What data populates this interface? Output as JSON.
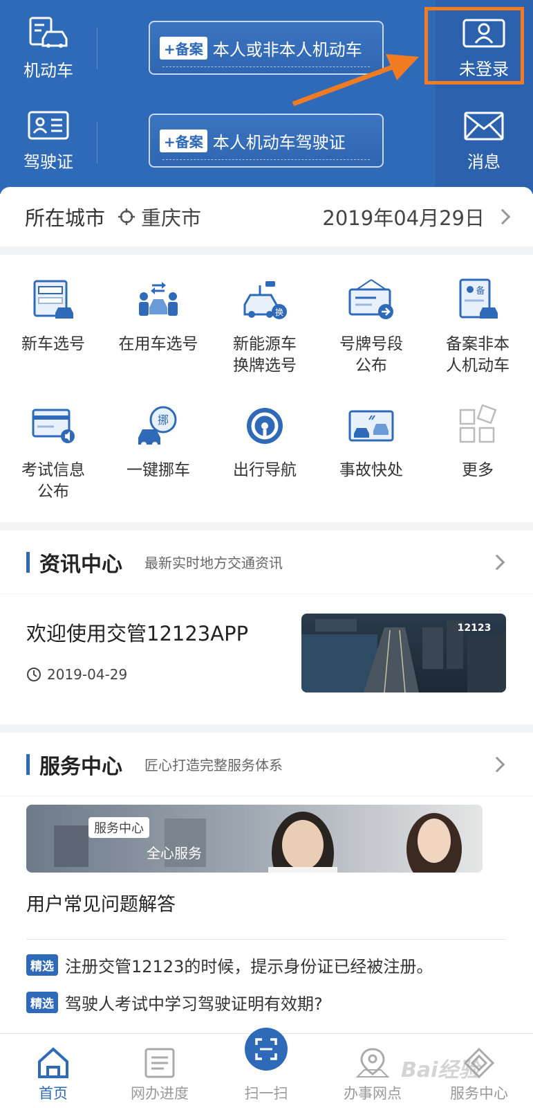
{
  "header": {
    "vehicle_label": "机动车",
    "license_label": "驾驶证",
    "ticket1": {
      "tag": "+备案",
      "text": "本人或非本人机动车"
    },
    "ticket2": {
      "tag": "+备案",
      "text": "本人机动车驾驶证"
    },
    "login_label": "未登录",
    "message_label": "消息",
    "highlight_color": "#f07b22"
  },
  "citybar": {
    "label": "所在城市",
    "city": "重庆市",
    "date": "2019年04月29日"
  },
  "services": [
    {
      "label": "新车选号",
      "icon": "new-car-plate-icon"
    },
    {
      "label": "在用车选号",
      "icon": "used-car-plate-icon"
    },
    {
      "label": "新能源车换牌选号",
      "icon": "ev-plate-icon"
    },
    {
      "label": "号牌号段公布",
      "icon": "plate-announce-icon"
    },
    {
      "label": "备案非本人机动车",
      "icon": "register-vehicle-icon"
    },
    {
      "label": "考试信息公布",
      "icon": "exam-info-icon"
    },
    {
      "label": "一键挪车",
      "icon": "move-car-icon"
    },
    {
      "label": "出行导航",
      "icon": "navigation-icon"
    },
    {
      "label": "事故快处",
      "icon": "accident-icon"
    },
    {
      "label": "更多",
      "icon": "more-icon"
    }
  ],
  "news": {
    "title": "资讯中心",
    "subtitle": "最新实时地方交通资讯",
    "item_title": "欢迎使用交管12123APP",
    "item_date": "2019-04-29",
    "image_text": "12123"
  },
  "service_center": {
    "title": "服务中心",
    "subtitle": "匠心打造完整服务体系",
    "banner_tag": "服务中心",
    "banner_text": "全心服务",
    "faq_heading": "用户常见问题解答",
    "faq": [
      {
        "badge": "精选",
        "text": "注册交管12123的时候，提示身份证已经被注册。"
      },
      {
        "badge": "精选",
        "text": "驾驶人考试中学习驾驶证明有效期?"
      }
    ]
  },
  "tabs": [
    {
      "label": "首页",
      "active": true
    },
    {
      "label": "网办进度",
      "active": false
    },
    {
      "label": "扫一扫",
      "active": false
    },
    {
      "label": "办事网点",
      "active": false
    },
    {
      "label": "服务中心",
      "active": false
    }
  ],
  "watermark": "Bai经验"
}
